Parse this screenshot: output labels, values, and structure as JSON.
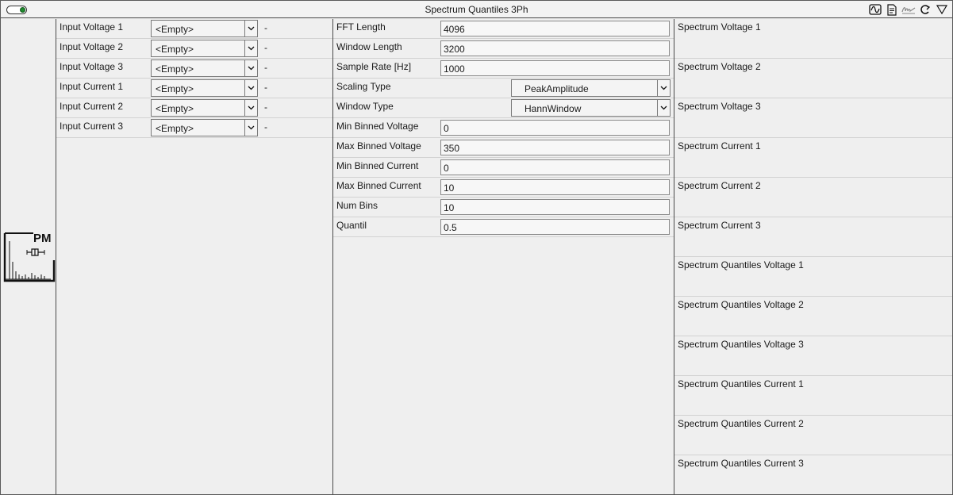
{
  "window": {
    "title": "Spectrum Quantiles 3Ph",
    "toggle_icon": "toggle-switch-on",
    "title_icons": [
      "waveform-icon",
      "document-icon",
      "signature-icon",
      "refresh-icon",
      "dropdown-triangle-icon"
    ]
  },
  "block": {
    "icon_label": "PM"
  },
  "inputs": [
    {
      "label": "Input Voltage 1",
      "value": "<Empty>",
      "unit": "-"
    },
    {
      "label": "Input Voltage 2",
      "value": "<Empty>",
      "unit": "-"
    },
    {
      "label": "Input Voltage 3",
      "value": "<Empty>",
      "unit": "-"
    },
    {
      "label": "Input Current 1",
      "value": "<Empty>",
      "unit": "-"
    },
    {
      "label": "Input Current 2",
      "value": "<Empty>",
      "unit": "-"
    },
    {
      "label": "Input Current 3",
      "value": "<Empty>",
      "unit": "-"
    }
  ],
  "params": [
    {
      "label": "FFT Length",
      "value": "4096"
    },
    {
      "label": "Window Length",
      "value": "3200"
    },
    {
      "label": "Sample Rate [Hz]",
      "value": "1000"
    },
    {
      "label": "Scaling Type",
      "value": "PeakAmplitude"
    },
    {
      "label": "Window Type",
      "value": "HannWindow"
    },
    {
      "label": "Min Binned Voltage",
      "value": "0"
    },
    {
      "label": "Max Binned Voltage",
      "value": "350"
    },
    {
      "label": "Min Binned Current",
      "value": "0"
    },
    {
      "label": "Max Binned Current",
      "value": "10"
    },
    {
      "label": "Num Bins",
      "value": "10"
    },
    {
      "label": "Quantil",
      "value": "0.5"
    }
  ],
  "outputs": [
    "Spectrum Voltage 1",
    "Spectrum Voltage 2",
    "Spectrum Voltage 3",
    "Spectrum Current 1",
    "Spectrum Current 2",
    "Spectrum Current 3",
    "Spectrum Quantiles Voltage 1",
    "Spectrum Quantiles Voltage 2",
    "Spectrum Quantiles Voltage 3",
    "Spectrum Quantiles Current 1",
    "Spectrum Quantiles Current 2",
    "Spectrum Quantiles Current 3"
  ]
}
